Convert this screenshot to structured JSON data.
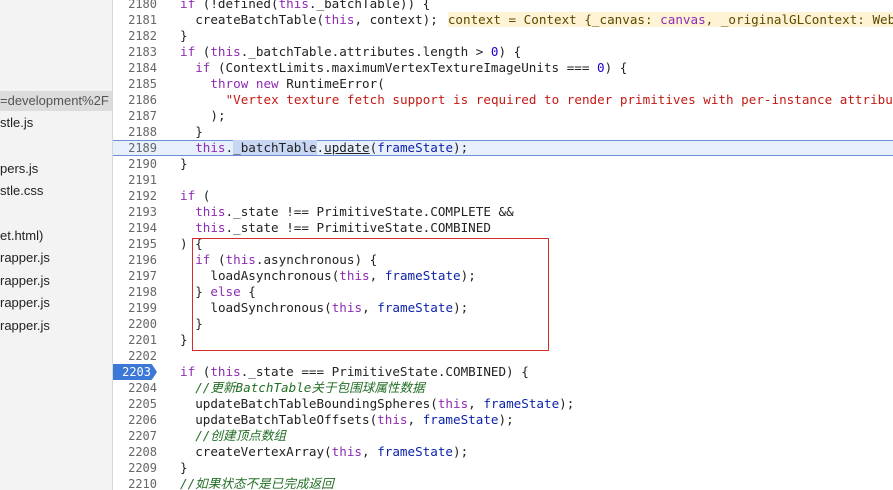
{
  "sidebar": {
    "items": [
      {
        "label": "=development%2F",
        "selected": true
      },
      {
        "label": "stle.js"
      },
      {
        "label": "pers.js"
      },
      {
        "label": "stle.css"
      },
      {
        "label": "et.html)"
      },
      {
        "label": "rapper.js"
      },
      {
        "label": "rapper.js"
      },
      {
        "label": "rapper.js"
      },
      {
        "label": "rapper.js"
      }
    ]
  },
  "editor": {
    "current_line": "2189",
    "breakpoint_line": "2203",
    "lines": [
      {
        "num": "2180",
        "indent": 0,
        "tokens": [
          [
            "kw",
            "if"
          ],
          [
            "p",
            " (!defined("
          ],
          [
            "kw",
            "this"
          ],
          [
            "p",
            "._batchTable)) {"
          ]
        ]
      },
      {
        "num": "2181",
        "indent": 1,
        "tokens": [
          [
            "p",
            "createBatchTable("
          ],
          [
            "kw",
            "this"
          ],
          [
            "p",
            ", context);"
          ]
        ],
        "inline_value": {
          "name": "context",
          "eq": " = Context {_canvas: ",
          "v1": "canvas",
          "mid": ", _originalGLContext: WebG"
        }
      },
      {
        "num": "2182",
        "indent": 0,
        "tokens": [
          [
            "p",
            "}"
          ]
        ]
      },
      {
        "num": "2183",
        "indent": 0,
        "tokens": [
          [
            "kw",
            "if"
          ],
          [
            "p",
            " ("
          ],
          [
            "kw",
            "this"
          ],
          [
            "p",
            "._batchTable.attributes.length > "
          ],
          [
            "num",
            "0"
          ],
          [
            "p",
            ") {"
          ]
        ]
      },
      {
        "num": "2184",
        "indent": 1,
        "tokens": [
          [
            "kw",
            "if"
          ],
          [
            "p",
            " (ContextLimits.maximumVertexTextureImageUnits === "
          ],
          [
            "num",
            "0"
          ],
          [
            "p",
            ") {"
          ]
        ]
      },
      {
        "num": "2185",
        "indent": 2,
        "tokens": [
          [
            "kw",
            "throw new"
          ],
          [
            "p",
            " RuntimeError("
          ]
        ]
      },
      {
        "num": "2186",
        "indent": 3,
        "tokens": [
          [
            "str",
            "\"Vertex texture fetch support is required to render primitives with per-instance attribute"
          ]
        ]
      },
      {
        "num": "2187",
        "indent": 2,
        "tokens": [
          [
            "p",
            ");"
          ]
        ]
      },
      {
        "num": "2188",
        "indent": 1,
        "tokens": [
          [
            "p",
            "}"
          ]
        ]
      },
      {
        "num": "2189",
        "indent": 1,
        "tokens": [
          [
            "kw",
            "this"
          ],
          [
            "p",
            "."
          ],
          [
            "hl",
            "_batchTable"
          ],
          [
            "p",
            "."
          ],
          [
            "ul",
            "update"
          ],
          [
            "p",
            "("
          ],
          [
            "var",
            "frameState"
          ],
          [
            "p",
            ");"
          ]
        ]
      },
      {
        "num": "2190",
        "indent": 0,
        "tokens": [
          [
            "p",
            "}"
          ]
        ]
      },
      {
        "num": "2191",
        "indent": 0,
        "tokens": []
      },
      {
        "num": "2192",
        "indent": 0,
        "tokens": [
          [
            "kw",
            "if"
          ],
          [
            "p",
            " ("
          ]
        ]
      },
      {
        "num": "2193",
        "indent": 1,
        "tokens": [
          [
            "kw",
            "this"
          ],
          [
            "p",
            "._state !== PrimitiveState.COMPLETE &&"
          ]
        ]
      },
      {
        "num": "2194",
        "indent": 1,
        "tokens": [
          [
            "kw",
            "this"
          ],
          [
            "p",
            "._state !== PrimitiveState.COMBINED"
          ]
        ]
      },
      {
        "num": "2195",
        "indent": 0,
        "tokens": [
          [
            "p",
            ") {"
          ]
        ]
      },
      {
        "num": "2196",
        "indent": 1,
        "tokens": [
          [
            "kw",
            "if"
          ],
          [
            "p",
            " ("
          ],
          [
            "kw",
            "this"
          ],
          [
            "p",
            ".asynchronous) {"
          ]
        ]
      },
      {
        "num": "2197",
        "indent": 2,
        "tokens": [
          [
            "p",
            "loadAsynchronous("
          ],
          [
            "kw",
            "this"
          ],
          [
            "p",
            ", "
          ],
          [
            "var",
            "frameState"
          ],
          [
            "p",
            ");"
          ]
        ]
      },
      {
        "num": "2198",
        "indent": 1,
        "tokens": [
          [
            "p",
            "} "
          ],
          [
            "kw",
            "else"
          ],
          [
            "p",
            " {"
          ]
        ]
      },
      {
        "num": "2199",
        "indent": 2,
        "tokens": [
          [
            "p",
            "loadSynchronous("
          ],
          [
            "kw",
            "this"
          ],
          [
            "p",
            ", "
          ],
          [
            "var",
            "frameState"
          ],
          [
            "p",
            ");"
          ]
        ]
      },
      {
        "num": "2200",
        "indent": 1,
        "tokens": [
          [
            "p",
            "}"
          ]
        ]
      },
      {
        "num": "2201",
        "indent": 0,
        "tokens": [
          [
            "p",
            "}"
          ]
        ]
      },
      {
        "num": "2202",
        "indent": 0,
        "tokens": []
      },
      {
        "num": "2203",
        "indent": 0,
        "tokens": [
          [
            "kw",
            "if"
          ],
          [
            "p",
            " ("
          ],
          [
            "kw",
            "this"
          ],
          [
            "p",
            "._state === PrimitiveState.COMBINED) {"
          ]
        ]
      },
      {
        "num": "2204",
        "indent": 1,
        "tokens": [
          [
            "cmt",
            "//更新BatchTable关于包围球属性数据"
          ]
        ]
      },
      {
        "num": "2205",
        "indent": 1,
        "tokens": [
          [
            "p",
            "updateBatchTableBoundingSpheres("
          ],
          [
            "kw",
            "this"
          ],
          [
            "p",
            ", "
          ],
          [
            "var",
            "frameState"
          ],
          [
            "p",
            ");"
          ]
        ]
      },
      {
        "num": "2206",
        "indent": 1,
        "tokens": [
          [
            "p",
            "updateBatchTableOffsets("
          ],
          [
            "kw",
            "this"
          ],
          [
            "p",
            ", "
          ],
          [
            "var",
            "frameState"
          ],
          [
            "p",
            ");"
          ]
        ]
      },
      {
        "num": "2207",
        "indent": 1,
        "tokens": [
          [
            "cmt",
            "//创建顶点数组"
          ]
        ]
      },
      {
        "num": "2208",
        "indent": 1,
        "tokens": [
          [
            "p",
            "createVertexArray("
          ],
          [
            "kw",
            "this"
          ],
          [
            "p",
            ", "
          ],
          [
            "var",
            "frameState"
          ],
          [
            "p",
            ");"
          ]
        ]
      },
      {
        "num": "2209",
        "indent": 0,
        "tokens": [
          [
            "p",
            "}"
          ]
        ]
      },
      {
        "num": "2210",
        "indent": 0,
        "tokens": [
          [
            "cmt",
            "//如果状态不是已完成返回"
          ]
        ]
      }
    ]
  }
}
